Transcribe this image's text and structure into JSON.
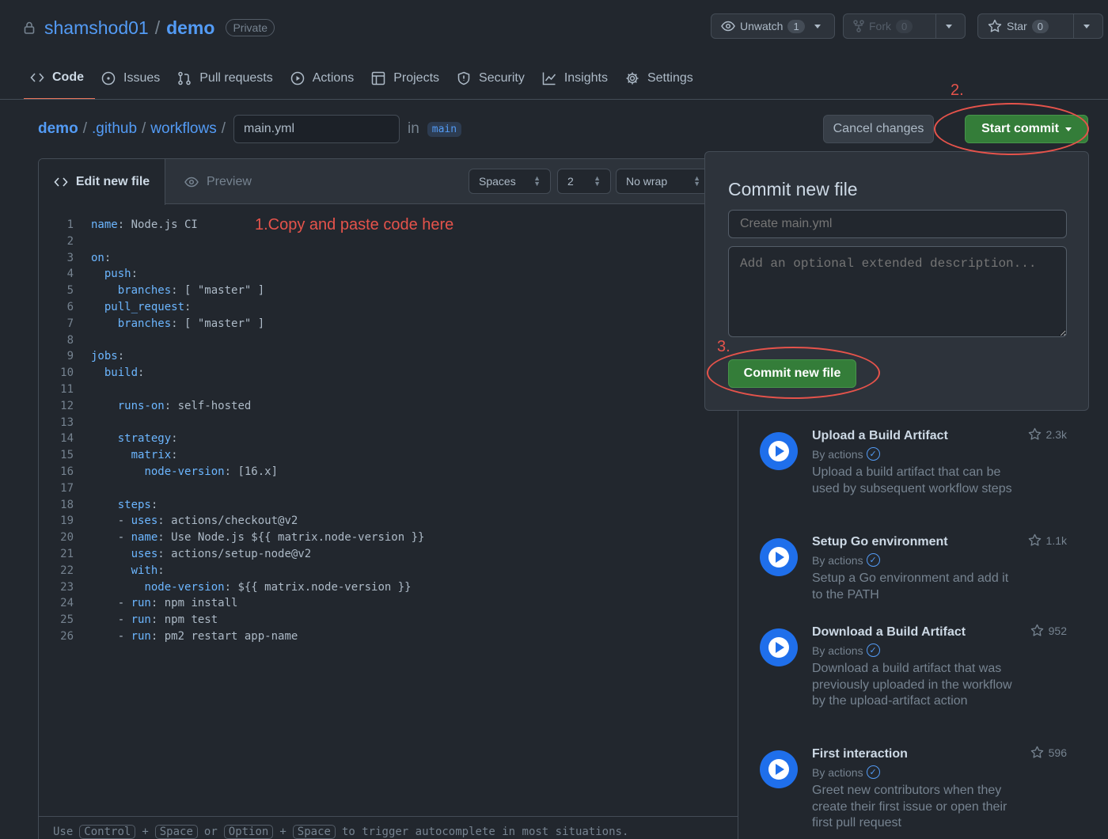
{
  "repo": {
    "owner": "shamshod01",
    "name": "demo",
    "visibility": "Private"
  },
  "header_buttons": {
    "unwatch": {
      "label": "Unwatch",
      "count": "1"
    },
    "fork": {
      "label": "Fork",
      "count": "0"
    },
    "star": {
      "label": "Star",
      "count": "0"
    }
  },
  "nav": {
    "items": [
      {
        "label": "Code",
        "icon": "code-icon"
      },
      {
        "label": "Issues",
        "icon": "issue-icon"
      },
      {
        "label": "Pull requests",
        "icon": "pull-request-icon"
      },
      {
        "label": "Actions",
        "icon": "play-icon"
      },
      {
        "label": "Projects",
        "icon": "table-icon"
      },
      {
        "label": "Security",
        "icon": "shield-icon"
      },
      {
        "label": "Insights",
        "icon": "graph-icon"
      },
      {
        "label": "Settings",
        "icon": "gear-icon"
      }
    ]
  },
  "breadcrumb": {
    "root": "demo",
    "folder1": ".github",
    "folder2": "workflows",
    "filename": "main.yml",
    "in": "in",
    "branch": "main"
  },
  "actions": {
    "cancel": "Cancel changes",
    "start_commit": "Start commit"
  },
  "editor": {
    "tab_edit": "Edit new file",
    "tab_preview": "Preview",
    "indent_mode": "Spaces",
    "indent_size": "2",
    "wrap_mode": "No wrap",
    "lines": [
      "name: Node.js CI",
      "",
      "on:",
      "  push:",
      "    branches: [ \"master\" ]",
      "  pull_request:",
      "    branches: [ \"master\" ]",
      "",
      "jobs:",
      "  build:",
      "",
      "    runs-on: self-hosted",
      "",
      "    strategy:",
      "      matrix:",
      "        node-version: [16.x]",
      "",
      "    steps:",
      "    - uses: actions/checkout@v2",
      "    - name: Use Node.js ${{ matrix.node-version }}",
      "      uses: actions/setup-node@v2",
      "      with:",
      "        node-version: ${{ matrix.node-version }}",
      "    - run: npm install",
      "    - run: npm test",
      "    - run: pm2 restart app-name"
    ],
    "hint": {
      "use": "Use",
      "k1": "Control",
      "plus1": "+",
      "k2": "Space",
      "or": "or",
      "k3": "Option",
      "plus2": "+",
      "k4": "Space",
      "rest": "to trigger autocomplete in most situations."
    }
  },
  "annotations": {
    "a1": "1.Copy and paste code here",
    "a2": "2.",
    "a3": "3."
  },
  "commit_panel": {
    "title": "Commit new file",
    "summary_placeholder": "Create main.yml",
    "description_placeholder": "Add an optional extended description...",
    "button": "Commit new file"
  },
  "marketplace": [
    {
      "title": "Upload a Build Artifact",
      "by": "By actions",
      "desc": "Upload a build artifact that can be used by subsequent workflow steps",
      "stars": "2.3k"
    },
    {
      "title": "Setup Go environment",
      "by": "By actions",
      "desc": "Setup a Go environment and add it to the PATH",
      "stars": "1.1k"
    },
    {
      "title": "Download a Build Artifact",
      "by": "By actions",
      "desc": "Download a build artifact that was previously uploaded in the workflow by the upload-artifact action",
      "stars": "952"
    },
    {
      "title": "First interaction",
      "by": "By actions",
      "desc": "Greet new contributors when they create their first issue or open their first pull request",
      "stars": "596"
    }
  ],
  "colors": {
    "accent": "#539bf5",
    "primary_button": "#347d39",
    "annotation": "#e5534b",
    "background": "#22272e"
  }
}
